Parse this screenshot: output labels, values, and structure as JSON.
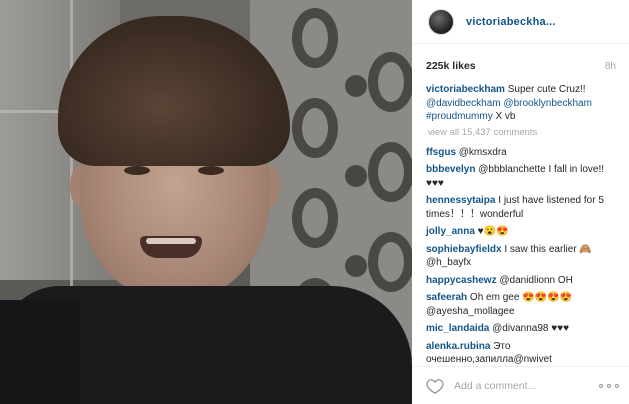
{
  "post": {
    "username": "victoriabeckha...",
    "likes": "225k likes",
    "time": "8h",
    "caption": {
      "user": "victoriabeckham",
      "text": " Super cute Cruz!! ",
      "mentions": "@davidbeckham @brooklynbeckham #proudmummy",
      "tail": " X vb"
    },
    "view_all": "view all 15,437 comments",
    "comments": [
      {
        "user": "ffsgus",
        "text": " @kmsxdra"
      },
      {
        "user": "bbbevelyn",
        "text": " @bbblanchette I fall in love!! ♥♥♥"
      },
      {
        "user": "hennessytaipa",
        "text": " I just have listened for 5 times！！！wonderful"
      },
      {
        "user": "jolly_anna",
        "text": " ♥😮😍"
      },
      {
        "user": "sophiebayfieldx",
        "text": " I saw this earlier 🙈 @h_bayfx"
      },
      {
        "user": "happycashewz",
        "text": " @danidlionn OH"
      },
      {
        "user": "safeerah",
        "text": " Oh em gee 😍😍😍😍 @ayesha_mollagee"
      },
      {
        "user": "mic_landaida",
        "text": " @divanna98 ♥♥♥"
      },
      {
        "user": "alenka.rubina",
        "text": " Это очешенно,запилла@nwivet"
      }
    ],
    "add_comment_placeholder": "Add a comment...",
    "icons": {
      "like": "heart-icon",
      "more": "more-options-icon"
    }
  }
}
